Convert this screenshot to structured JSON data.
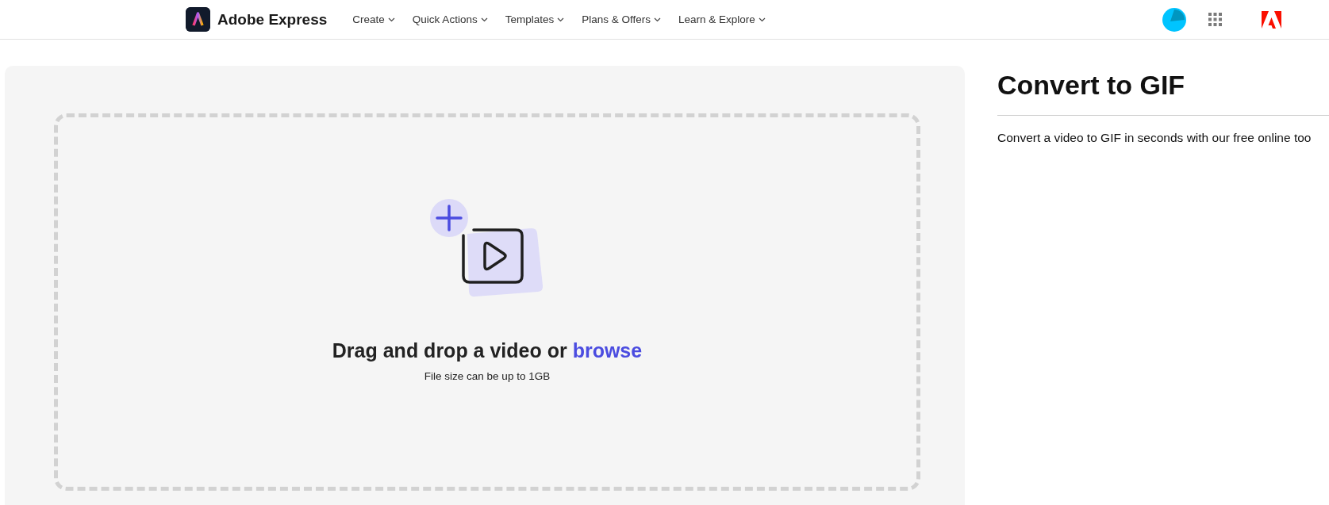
{
  "header": {
    "brand": "Adobe Express",
    "nav": [
      {
        "label": "Create"
      },
      {
        "label": "Quick Actions"
      },
      {
        "label": "Templates"
      },
      {
        "label": "Plans & Offers"
      },
      {
        "label": "Learn & Explore"
      }
    ]
  },
  "upload": {
    "prompt": "Drag and drop a video or",
    "link": "browse",
    "hint": "File size can be up to 1GB"
  },
  "side": {
    "title": "Convert to GIF",
    "description": "Convert a video to GIF in seconds with our free online too"
  }
}
